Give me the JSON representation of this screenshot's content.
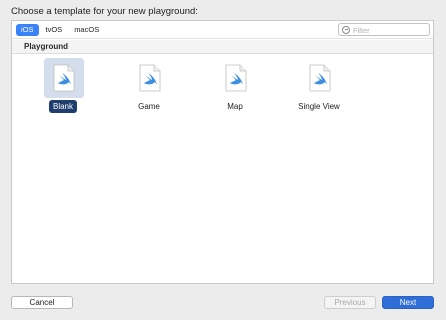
{
  "dialog": {
    "heading": "Choose a template for your new playground:"
  },
  "platform_tabs": [
    {
      "label": "iOS",
      "selected": true
    },
    {
      "label": "tvOS",
      "selected": false
    },
    {
      "label": "macOS",
      "selected": false
    }
  ],
  "filter": {
    "placeholder": "Filter",
    "value": ""
  },
  "section": {
    "title": "Playground"
  },
  "templates": [
    {
      "label": "Blank",
      "selected": true,
      "icon": "swift-file-icon"
    },
    {
      "label": "Game",
      "selected": false,
      "icon": "swift-file-icon"
    },
    {
      "label": "Map",
      "selected": false,
      "icon": "swift-file-icon"
    },
    {
      "label": "Single View",
      "selected": false,
      "icon": "swift-file-icon"
    }
  ],
  "buttons": {
    "cancel": "Cancel",
    "previous": "Previous",
    "next": "Next"
  },
  "colors": {
    "accent": "#3a82f7",
    "selection": "#1f3e6d",
    "swift_orange": "#3f8fe0",
    "primary_button": "#2f6ed8"
  }
}
